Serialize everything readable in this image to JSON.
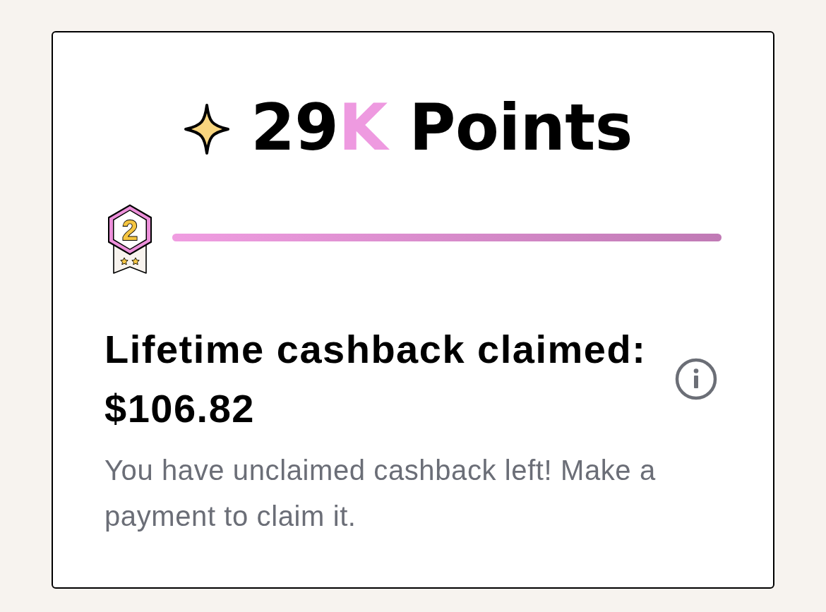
{
  "points": {
    "amount": "29",
    "unit": "K",
    "label": "Points"
  },
  "tier": {
    "badge": "2",
    "progress": {
      "level": 1
    }
  },
  "cashback": {
    "label": "Lifetime cashback claimed:",
    "amount": "$106.82",
    "note": "You have unclaimed cashback left! Make a payment to claim it."
  }
}
